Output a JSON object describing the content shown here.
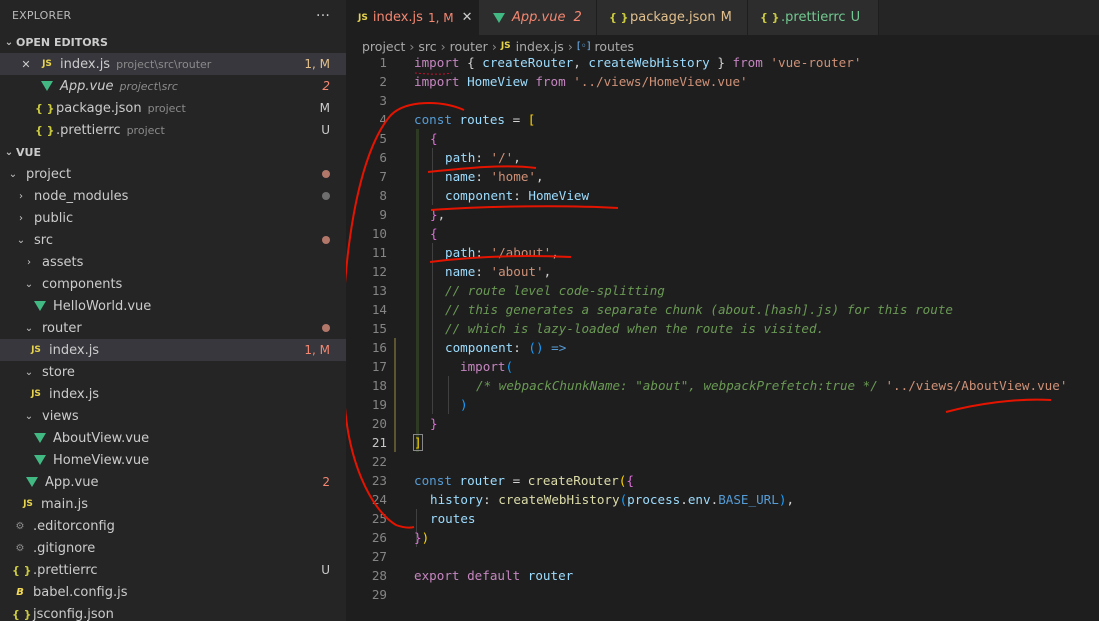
{
  "explorer": {
    "title": "EXPLORER",
    "more": "···",
    "open_editors": {
      "title": "OPEN EDITORS",
      "items": [
        {
          "name": "index.js",
          "desc": "project\\src\\router",
          "status": "1, M",
          "close": "✕"
        },
        {
          "name": "App.vue",
          "desc": "project\\src",
          "status": "2"
        },
        {
          "name": "package.json",
          "desc": "project",
          "status": "M"
        },
        {
          "name": ".prettierrc",
          "desc": "project",
          "status": "U"
        }
      ]
    },
    "workspace": {
      "title": "VUE",
      "tree": [
        {
          "name": "project",
          "type": "folder"
        },
        {
          "name": "node_modules",
          "type": "folder"
        },
        {
          "name": "public",
          "type": "folder"
        },
        {
          "name": "src",
          "type": "folder"
        },
        {
          "name": "assets",
          "type": "folder"
        },
        {
          "name": "components",
          "type": "folder"
        },
        {
          "name": "HelloWorld.vue",
          "type": "vue"
        },
        {
          "name": "router",
          "type": "folder"
        },
        {
          "name": "index.js",
          "type": "js",
          "status": "1, M"
        },
        {
          "name": "store",
          "type": "folder"
        },
        {
          "name": "index.js",
          "type": "js"
        },
        {
          "name": "views",
          "type": "folder"
        },
        {
          "name": "AboutView.vue",
          "type": "vue"
        },
        {
          "name": "HomeView.vue",
          "type": "vue"
        },
        {
          "name": "App.vue",
          "type": "vue",
          "status": "2"
        },
        {
          "name": "main.js",
          "type": "js"
        },
        {
          "name": ".editorconfig",
          "type": "config"
        },
        {
          "name": ".gitignore",
          "type": "config"
        },
        {
          "name": ".prettierrc",
          "type": "json",
          "status": "U"
        },
        {
          "name": "babel.config.js",
          "type": "babel"
        },
        {
          "name": "jsconfig.json",
          "type": "json"
        }
      ]
    }
  },
  "icons": {
    "js": "JS",
    "json": "{ }",
    "config": "⚙",
    "babel": "B",
    "chevron_down": "⌄",
    "chevron_right": "›"
  },
  "tabs": [
    {
      "label": "index.js",
      "status": "1, M",
      "close": "✕"
    },
    {
      "label": "App.vue",
      "status": "2"
    },
    {
      "label": "package.json",
      "status": "M"
    },
    {
      "label": ".prettierrc",
      "status": "U"
    }
  ],
  "breadcrumb": {
    "items": [
      "project",
      "src",
      "router",
      "index.js",
      "routes"
    ],
    "sep": "›",
    "symbol_icon": "[◦]"
  },
  "code": {
    "l1": {
      "n": "1",
      "a": "import",
      "b": " { ",
      "c": "createRouter",
      "d": ", ",
      "e": "createWebHistory",
      "f": " } ",
      "g": "from",
      "h": " 'vue-router'"
    },
    "l2": {
      "n": "2",
      "a": "import",
      "b": " HomeView ",
      "c": "from",
      "d": " '../views/HomeView.vue'"
    },
    "l3": {
      "n": "3"
    },
    "l4": {
      "n": "4",
      "a": "const",
      "b": " routes",
      "c": " = ",
      "d": "["
    },
    "l5": {
      "n": "5",
      "a": "{"
    },
    "l6": {
      "n": "6",
      "a": "path",
      "b": ": ",
      "c": "'/'",
      "d": ","
    },
    "l7": {
      "n": "7",
      "a": "name",
      "b": ": ",
      "c": "'home'",
      "d": ","
    },
    "l8": {
      "n": "8",
      "a": "component",
      "b": ": ",
      "c": "HomeView"
    },
    "l9": {
      "n": "9",
      "a": "}",
      "b": ","
    },
    "l10": {
      "n": "10",
      "a": "{"
    },
    "l11": {
      "n": "11",
      "a": "path",
      "b": ": ",
      "c": "'/about'",
      "d": ","
    },
    "l12": {
      "n": "12",
      "a": "name",
      "b": ": ",
      "c": "'about'",
      "d": ","
    },
    "l13": {
      "n": "13",
      "a": "// route level code-splitting"
    },
    "l14": {
      "n": "14",
      "a": "// this generates a separate chunk (about.[hash].js) for this route"
    },
    "l15": {
      "n": "15",
      "a": "// which is lazy-loaded when the route is visited."
    },
    "l16": {
      "n": "16",
      "a": "component",
      "b": ": ",
      "c": "()",
      "d": " => "
    },
    "l17": {
      "n": "17",
      "a": "import",
      "b": "("
    },
    "l18": {
      "n": "18",
      "a": "/* webpackChunkName: \"about\", webpackPrefetch:true */",
      "b": " '../views/AboutView.vue'"
    },
    "l19": {
      "n": "19",
      "a": ")"
    },
    "l20": {
      "n": "20",
      "a": "}"
    },
    "l21": {
      "n": "21",
      "a": "]"
    },
    "l22": {
      "n": "22"
    },
    "l23": {
      "n": "23",
      "a": "const",
      "b": " router",
      "c": " = ",
      "d": "createRouter",
      "e": "(",
      "f": "{"
    },
    "l24": {
      "n": "24",
      "a": "history",
      "b": ": ",
      "c": "createWebHistory",
      "d": "(",
      "e": "process",
      "f": ".",
      "g": "env",
      "h": ".",
      "i": "BASE_URL",
      "j": ")",
      "k": ","
    },
    "l25": {
      "n": "25",
      "a": "routes"
    },
    "l26": {
      "n": "26",
      "a": "}",
      "b": ")"
    },
    "l27": {
      "n": "27"
    },
    "l28": {
      "n": "28",
      "a": "export",
      "b": " default",
      "c": " router"
    },
    "l29": {
      "n": "29"
    }
  },
  "colors": {
    "modified": "#e2c08d",
    "error": "#f48771",
    "vue": "#42b883",
    "annotation": "#e51400"
  }
}
